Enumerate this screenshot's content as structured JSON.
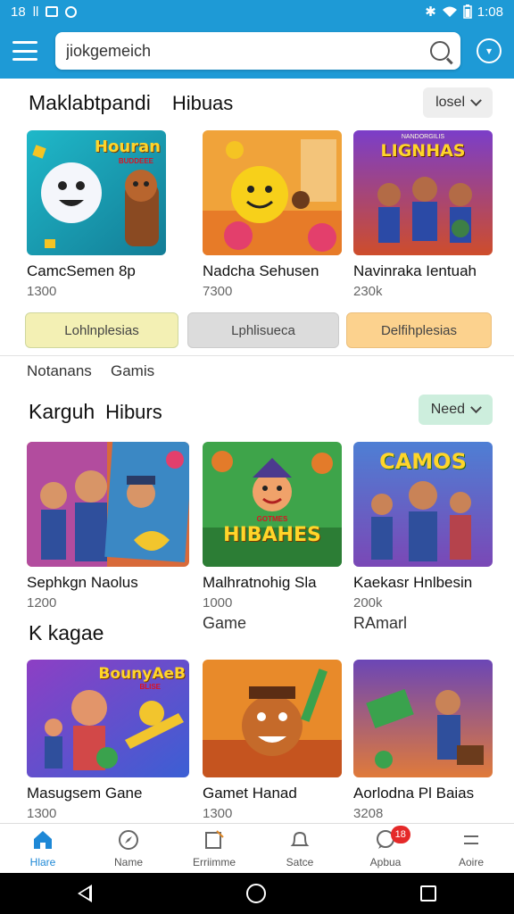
{
  "status": {
    "time_left": "18",
    "label_left": "ll",
    "time_right": "1:08"
  },
  "search": {
    "value": "jiokgemeich"
  },
  "section1": {
    "title": "Maklabtpandi",
    "subtitle": "Hibuas",
    "pill": "losel",
    "cards": [
      {
        "title": "CamcSemen 8p",
        "count": "1300",
        "art_text": "Houran",
        "art_sub": "BUDDEEE"
      },
      {
        "title": "Nadcha Sehusen",
        "count": "7300",
        "art_text": "",
        "art_sub": ""
      },
      {
        "title": "Navinraka Ientuah",
        "count": "230k",
        "art_text": "LIGNHAS",
        "art_sub": "NANDORGILIS"
      }
    ]
  },
  "tags": [
    "Lohlnplesias",
    "Lphlisueca",
    "Delfihplesias"
  ],
  "row_labels": [
    "Notanans",
    "Gamis"
  ],
  "section2": {
    "title": "Karguh",
    "subtitle": "Hiburs",
    "pill": "Need",
    "cards": [
      {
        "title": "Sephkgn Naolus",
        "count": "1200",
        "art_text": "",
        "art_sub": ""
      },
      {
        "title": "Malhratnohig Sla",
        "count": "1000",
        "art_text": "HIBAHES",
        "art_sub": "GOTMES"
      },
      {
        "title": "Kaekasr Hnlbesin",
        "count": "200k",
        "art_text": "CAMOS",
        "art_sub": ""
      }
    ]
  },
  "section3": {
    "title": "K kagae",
    "labels": [
      "Game",
      "RAmarl"
    ],
    "cards": [
      {
        "title": "Masugsem Gane",
        "count": "1300",
        "art_text": "BounyAeB",
        "art_sub": "BLISE"
      },
      {
        "title": "Gamet Hanad",
        "count": "1300",
        "art_text": "",
        "art_sub": ""
      },
      {
        "title": "Aorlodna Pl Baias",
        "count": "3208",
        "art_text": "",
        "art_sub": ""
      }
    ]
  },
  "bottom_nav": [
    {
      "label": "Hlare",
      "icon": "home-icon"
    },
    {
      "label": "Name",
      "icon": "compass-icon"
    },
    {
      "label": "Erriimme",
      "icon": "edit-icon"
    },
    {
      "label": "Satce",
      "icon": "bell-icon"
    },
    {
      "label": "Apbua",
      "icon": "chat-icon",
      "badge": "18"
    },
    {
      "label": "Aoire",
      "icon": "more-icon"
    }
  ],
  "colors": {
    "accent": "#1e9ad6",
    "nav_active": "#1e88d6",
    "tag_1": "#f3f0b4",
    "tag_2": "#dcdcdc",
    "tag_3": "#fcd28e",
    "pill_1": "#eeeeee",
    "pill_2": "#cdeedd",
    "badge": "#e52929"
  }
}
